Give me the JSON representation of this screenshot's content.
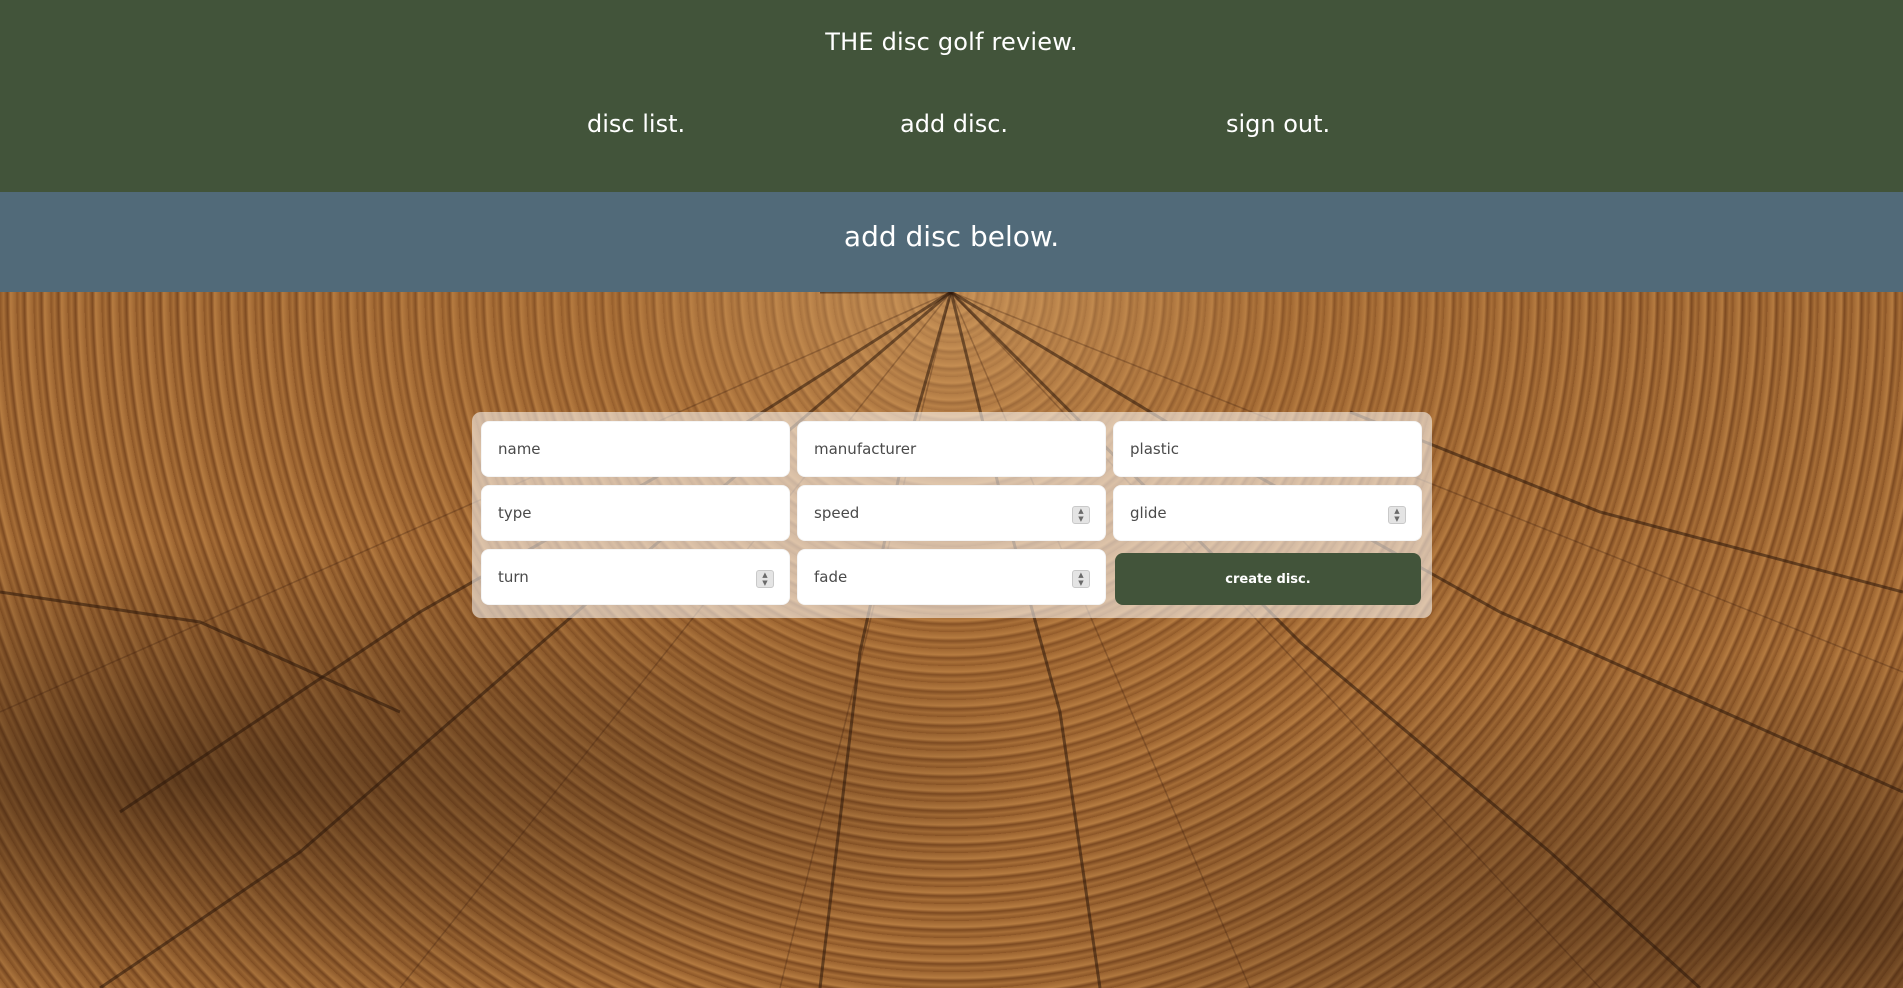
{
  "header": {
    "title": "THE disc golf review.",
    "nav": {
      "disc_list": "disc list.",
      "add_disc": "add disc.",
      "sign_out": "sign out."
    },
    "bg_color": "#42543a"
  },
  "banner": {
    "title": "add disc below.",
    "bg_color": "#516a79"
  },
  "form": {
    "name_placeholder": "name",
    "manufacturer_placeholder": "manufacturer",
    "plastic_placeholder": "plastic",
    "type_placeholder": "type",
    "speed_placeholder": "speed",
    "glide_placeholder": "glide",
    "turn_placeholder": "turn",
    "fade_placeholder": "fade",
    "submit_label": "create disc."
  }
}
